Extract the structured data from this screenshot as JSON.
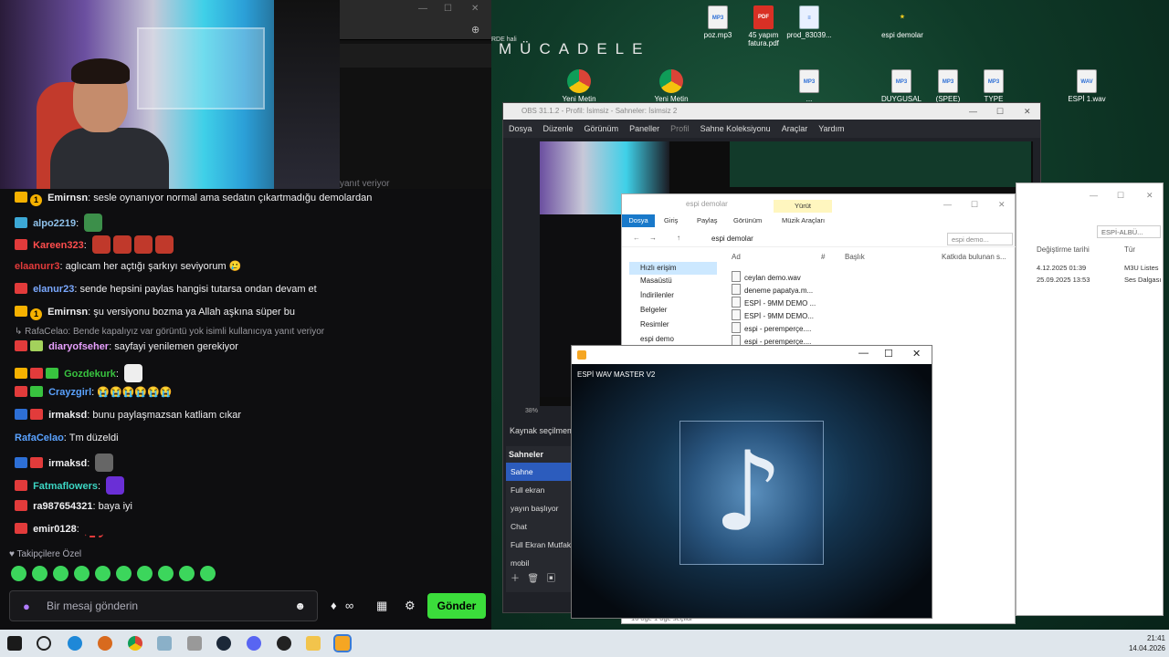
{
  "chat": {
    "reply_ghost": "yanıt veriyor",
    "messages": [
      {
        "user": "Emirnsn",
        "text": "sesle oynanıyor normal ama sedatın çıkartmadığu demolardan",
        "color": "#efeff1",
        "badges": [
          "gold",
          "num"
        ]
      },
      {
        "user": "alpo2219",
        "text": "",
        "color": "#8fc1ea",
        "badges": [
          "cyan"
        ]
      },
      {
        "user": "Kareen323",
        "text": "",
        "color": "#ff4d4d",
        "badges": [
          "red"
        ]
      },
      {
        "user": "elaanurr3",
        "text": "aglıcam her açtığı şarkıyı seviyorum 🥲",
        "color": "#e23b3b",
        "badges": []
      },
      {
        "user": "elanur23",
        "text": "sende hepsini paylas hangisi tutarsa ondan devam et",
        "color": "#7aa8ff",
        "badges": [
          "red"
        ]
      },
      {
        "user": "Emirnsn",
        "text": "şu versiyonu bozma ya Allah aşkına süper bu",
        "color": "#efeff1",
        "badges": [
          "gold",
          "num"
        ]
      }
    ],
    "reply_line": "↳ RafaCelao: Bende kapalıyız var görüntü yok isimli kullanıcıya yanıt veriyor",
    "messages2": [
      {
        "user": "diaryofseher",
        "text": "sayfayi yenilemen gerekiyor",
        "color": "#e8a0ff",
        "badges": [
          "red",
          "gift"
        ]
      },
      {
        "user": "Gozdekurk",
        "text": "",
        "color": "#38c23f",
        "badges": [
          "gold",
          "red",
          "green"
        ]
      },
      {
        "user": "Crayzgirl",
        "text": "😭😭😭😭😭😭",
        "color": "#5aa2ff",
        "badges": [
          "red",
          "green"
        ]
      },
      {
        "user": "irmaksd",
        "text": "bunu paylaşmazsan katliam cıkar",
        "color": "#efeff1",
        "badges": [
          "blue",
          "red"
        ]
      },
      {
        "user": "RafaCelao",
        "text": "Tm düzeldi",
        "color": "#5aa2ff",
        "badges": []
      },
      {
        "user": "irmaksd",
        "text": "",
        "color": "#efeff1",
        "badges": [
          "blue",
          "red"
        ]
      },
      {
        "user": "Fatmaflowers",
        "text": "",
        "color": "#3cd6c3",
        "badges": [
          "red"
        ]
      },
      {
        "user": "ra987654321",
        "text": "baya iyi",
        "color": "#efeff1",
        "badges": [
          "red"
        ]
      },
      {
        "user": "emir0128",
        "text": "",
        "color": "#efeff1",
        "badges": [
          "red"
        ]
      }
    ],
    "follower_label": "♥ Takipçilere Özel",
    "input_placeholder": "Bir mesaj gönderin",
    "send_label": "Gönder"
  },
  "desktop": {
    "title": "MÜCADELE",
    "fragment": "RDE\nhali",
    "icons": [
      {
        "label": "poz.mp3",
        "kind": "mp3"
      },
      {
        "label": "45 yapım fatura.pdf",
        "kind": "pdf"
      },
      {
        "label": "prod_83039...",
        "kind": "doc"
      },
      {
        "label": "espi demolar",
        "kind": "star"
      },
      {
        "label": "Yeni Metin",
        "kind": "chrome"
      },
      {
        "label": "Yeni Metin",
        "kind": "chrome"
      },
      {
        "label": "...",
        "kind": "mp3"
      },
      {
        "label": "DUYGUSAL",
        "kind": "mp3"
      },
      {
        "label": "(SPEE)",
        "kind": "mp3"
      },
      {
        "label": "TYPE",
        "kind": "mp3"
      },
      {
        "label": "ESPİ 1.wav",
        "kind": "wav"
      }
    ]
  },
  "obs": {
    "title": "OBS 31.1.2 - Profil: İsimsiz - Sahneler: İsimsiz 2",
    "menu": [
      "Dosya",
      "Düzenle",
      "Görünüm",
      "Paneller",
      "Profil",
      "Sahne Koleksiyonu",
      "Araçlar",
      "Yardım"
    ],
    "zoom": "38%",
    "source_label": "Kaynak seçilmem",
    "scenes_header": "Sahneler",
    "scenes": [
      "Sahne",
      "Full ekran",
      "yayın başlıyor",
      "Chat",
      "Full Ekran Mutfak",
      "mobil"
    ]
  },
  "explorer": {
    "title": "espi demolar",
    "ribbon": {
      "dosya": "Dosya",
      "giris": "Giriş",
      "paylas": "Paylaş",
      "gorunum": "Görünüm",
      "muzik": "Müzik Araçları",
      "yurut": "Yürüt"
    },
    "path": "espi demolar",
    "search": "espi demo...",
    "nav": [
      "Hızlı erişim",
      "Masaüstü",
      "İndirilenler",
      "Belgeler",
      "Resimler",
      "espi demo"
    ],
    "headers": {
      "ad": "Ad",
      "num": "#",
      "baslik": "Başlık",
      "katkida": "Katkıda bulunan s..."
    },
    "files": [
      "ceylan demo.wav",
      "deneme papatya.m...",
      "ESPİ - 9MM DEMO ...",
      "ESPİ - 9MM DEMO...",
      "espi - peremperçe....",
      "espi - peremperçe...."
    ],
    "status": "16 öğe      1 öğe seçildi"
  },
  "explorer2": {
    "crumb": "ESPİ-ALBÜ...",
    "h_date": "Değiştirme tarihi",
    "h_type": "Tür",
    "rows": [
      {
        "date": "4.12.2025 01:39",
        "type": "M3U Listes"
      },
      {
        "date": "25.09.2025 13:53",
        "type": "Ses Dalgası"
      }
    ]
  },
  "wav": {
    "title": "ESPİ WAV MASTER V2"
  },
  "taskbar": {
    "time": "21:41",
    "date": "14.04.2026"
  }
}
